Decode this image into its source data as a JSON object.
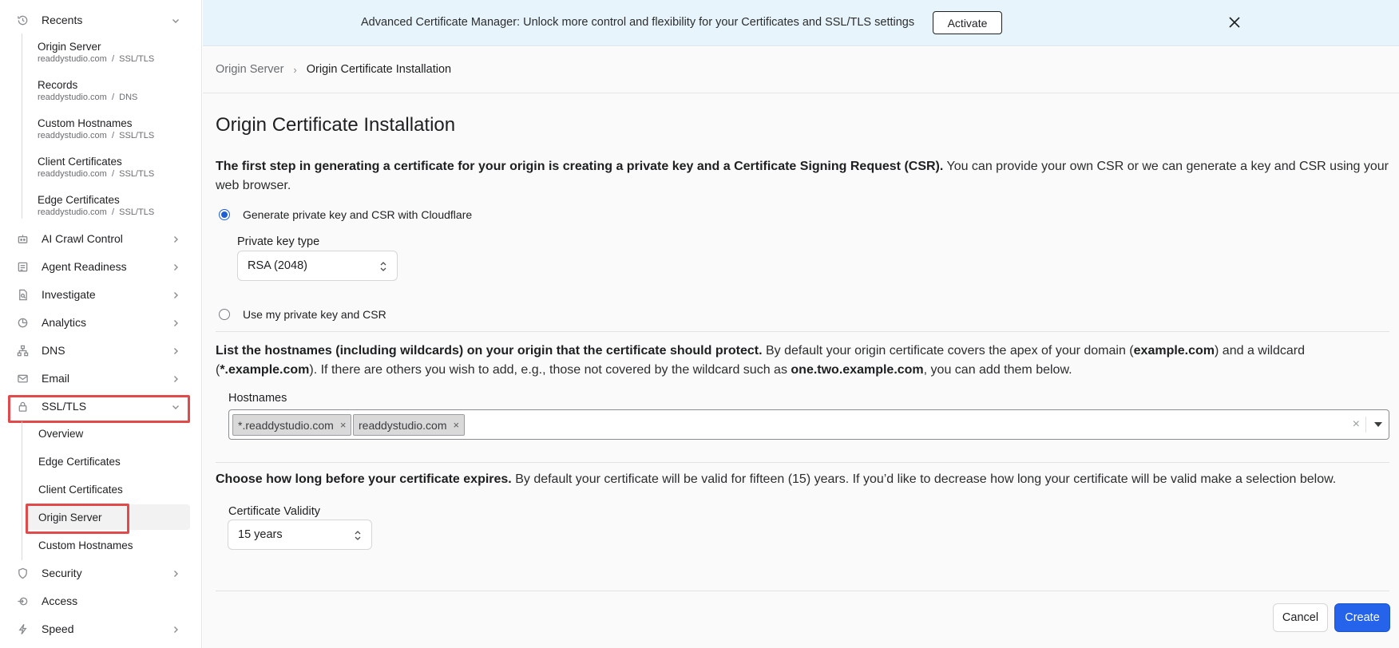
{
  "sidebar": {
    "recents": {
      "label": "Recents",
      "items": [
        {
          "title": "Origin Server",
          "domain": "readdystudio.com",
          "section": "SSL/TLS"
        },
        {
          "title": "Records",
          "domain": "readdystudio.com",
          "section": "DNS"
        },
        {
          "title": "Custom Hostnames",
          "domain": "readdystudio.com",
          "section": "SSL/TLS"
        },
        {
          "title": "Client Certificates",
          "domain": "readdystudio.com",
          "section": "SSL/TLS"
        },
        {
          "title": "Edge Certificates",
          "domain": "readdystudio.com",
          "section": "SSL/TLS"
        }
      ]
    },
    "nav": [
      {
        "label": "AI Crawl Control",
        "icon": "robot-icon"
      },
      {
        "label": "Agent Readiness",
        "icon": "checklist-icon"
      },
      {
        "label": "Investigate",
        "icon": "document-search-icon"
      },
      {
        "label": "Analytics",
        "icon": "pie-chart-icon"
      },
      {
        "label": "DNS",
        "icon": "network-icon"
      },
      {
        "label": "Email",
        "icon": "envelope-icon"
      },
      {
        "label": "SSL/TLS",
        "icon": "lock-icon"
      }
    ],
    "ssl_sub": [
      "Overview",
      "Edge Certificates",
      "Client Certificates",
      "Origin Server",
      "Custom Hostnames"
    ],
    "nav_bottom": [
      {
        "label": "Security",
        "icon": "shield-icon"
      },
      {
        "label": "Access",
        "icon": "access-icon"
      },
      {
        "label": "Speed",
        "icon": "lightning-icon"
      }
    ],
    "separator": "/"
  },
  "banner": {
    "text": "Advanced Certificate Manager: Unlock more control and flexibility for your Certificates and SSL/TLS settings",
    "button": "Activate"
  },
  "breadcrumb": {
    "parent": "Origin Server",
    "separator": "›",
    "current": "Origin Certificate Installation"
  },
  "page": {
    "title": "Origin Certificate Installation",
    "intro_bold": "The first step in generating a certificate for your origin is creating a private key and a Certificate Signing Request (CSR).",
    "intro_rest": " You can provide your own CSR or we can generate a key and CSR using your web browser.",
    "radio_generate": "Generate private key and CSR with Cloudflare",
    "private_key_label": "Private key type",
    "private_key_value": "RSA (2048)",
    "radio_own": "Use my private key and CSR",
    "host_bold": "List the hostnames (including wildcards) on your origin that the certificate should protect.",
    "host_p1": " By default your origin certificate covers the apex of your domain (",
    "host_b1": "example.com",
    "host_p2": ") and a wildcard (",
    "host_b2": "*.example.com",
    "host_p3": "). If there are others you wish to add, e.g., those not covered by the wildcard such as ",
    "host_b3": "one.two.example.com",
    "host_p4": ", you can add them below.",
    "hostnames_label": "Hostnames",
    "hostnames": [
      "*.readdystudio.com",
      "readdystudio.com"
    ],
    "tag_remove": "×",
    "clear_all": "×",
    "validity_bold": "Choose how long before your certificate expires.",
    "validity_rest": " By default your certificate will be valid for fifteen (15) years. If you’d like to decrease how long your certificate will be valid make a selection below.",
    "validity_label": "Certificate Validity",
    "validity_value": "15 years",
    "cancel": "Cancel",
    "create": "Create"
  },
  "colors": {
    "accent": "#2563eb",
    "banner_bg": "#e8f4fb",
    "highlight": "#e04a4a"
  }
}
